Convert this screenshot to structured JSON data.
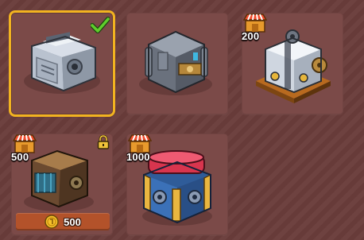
{
  "colors": {
    "background": "#6a3d3b",
    "card": "#7b4a48",
    "selected_border": "#f2b320",
    "check": "#5fce2c",
    "coin_bar": "#b3522a"
  },
  "items": [
    {
      "name": "steel-safe",
      "selected": true,
      "price": "",
      "icon": "check-icon"
    },
    {
      "name": "gear-safe",
      "selected": false,
      "price": ""
    },
    {
      "name": "white-gear-cube",
      "selected": false,
      "price": "200",
      "icon": "shop-icon"
    },
    {
      "name": "wooden-vault",
      "selected": false,
      "price": "500",
      "icon": "shop-icon",
      "locked": true,
      "coin_cost": "500"
    },
    {
      "name": "red-gold-vault",
      "selected": false,
      "price": "1000",
      "icon": "shop-icon"
    }
  ]
}
